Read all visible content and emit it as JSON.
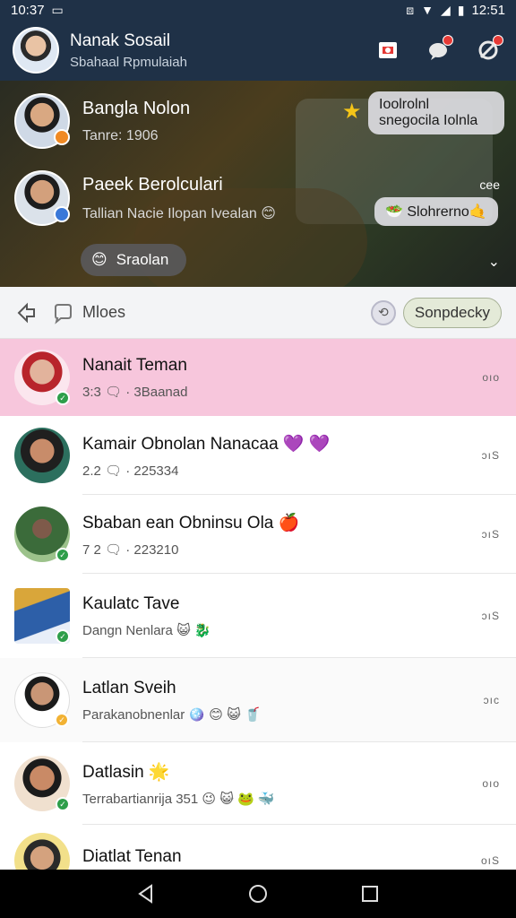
{
  "status_bar": {
    "time_left": "10:37",
    "battery": "12:51"
  },
  "header": {
    "title": "Nanak Sosail",
    "subtitle": "Sbahaal Rpmulaiah"
  },
  "preview": {
    "rows": [
      {
        "name": "Bangla Nolon",
        "sub": "Tanre: 1906"
      },
      {
        "name": "Paeek Berolculari",
        "sub": "Tallian Nacie Ilopan Ivealan 😊"
      }
    ],
    "bubble_top": "Ioolrolnl snegocila Iolnla",
    "bubble_mid": "🥗 Slohrerno🤙",
    "more_label": "cee",
    "pill_label": "Sraolan"
  },
  "toolbar": {
    "label": "Mloes",
    "sort_label": "Sonpdecky"
  },
  "chats": [
    {
      "name": "Nanait Teman",
      "meta": "3:3 🗨 · 3Baanad",
      "time": "oıo",
      "highlight": true,
      "badge": "#2e9e4a"
    },
    {
      "name": "Kamair Obnolan Nanacaa 💜 💜",
      "meta": "2.2 🗨 · 225334",
      "time": "ɔıS",
      "highlight": false,
      "badge": ""
    },
    {
      "name": "Sbaban ean Obninsu Ola 🍎",
      "meta": "7 2 🗨 · 223210",
      "time": "ɔıS",
      "highlight": false,
      "badge": "#2e9e4a"
    },
    {
      "name": "Kaulatc Tave",
      "meta": "Dangn Nenlara 😺 🐉",
      "time": "ɔıS",
      "highlight": false,
      "badge": "#2e9e4a"
    },
    {
      "name": "Latlan Sveih",
      "meta": "Parakanobnenlar 🪩 😊 😺 🥤",
      "time": "ɔıc",
      "highlight": false,
      "badge": "#f2b233"
    },
    {
      "name": "Datlasin 🌟",
      "meta": "Terrabartianrija 351 😉 😺 🐸 🐳",
      "time": "oıo",
      "highlight": false,
      "badge": "#2e9e4a"
    },
    {
      "name": "Diatlat Tenan",
      "meta": "",
      "time": "oıS",
      "highlight": false,
      "badge": ""
    }
  ],
  "colors": {
    "header_bg": "#1f3147",
    "highlight": "#f7c6dc",
    "online": "#2e9e4a"
  },
  "icons": [
    "back-icon",
    "home-icon",
    "recents-icon",
    "camera-icon",
    "chat-icon",
    "settings-icon"
  ]
}
